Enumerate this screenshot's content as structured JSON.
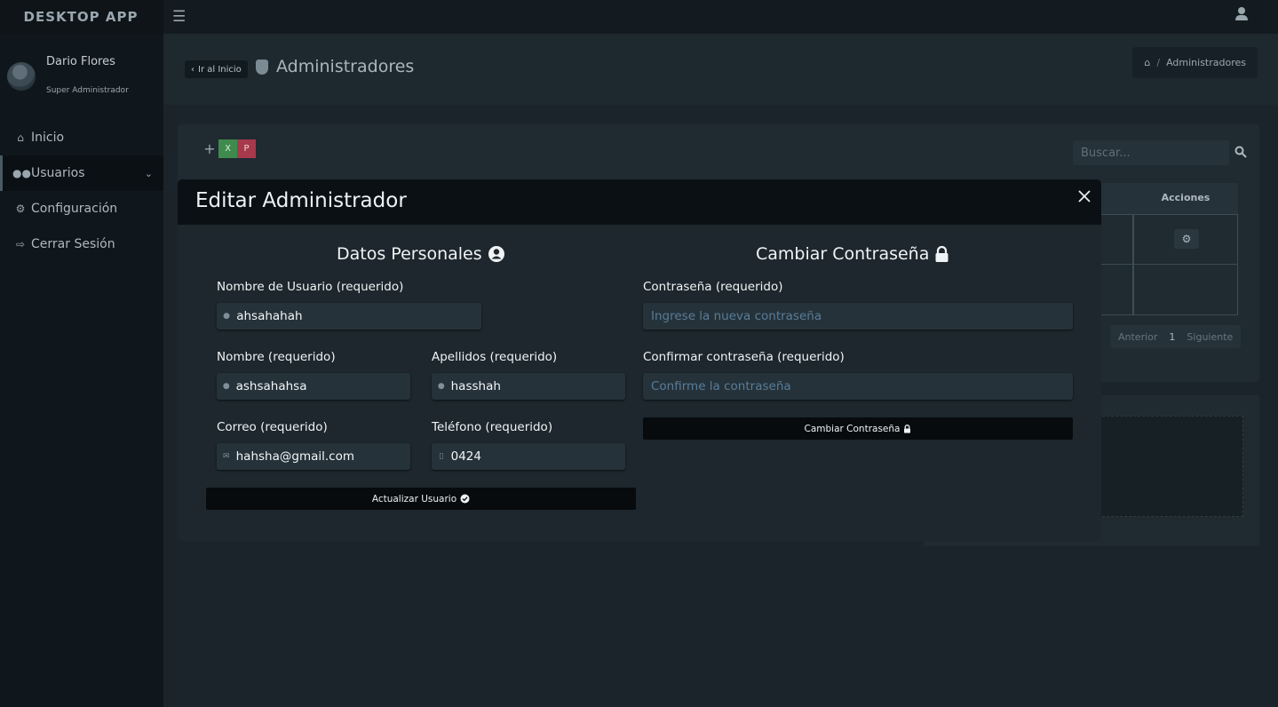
{
  "app": {
    "brand": "DESKTOP APP"
  },
  "user": {
    "name": "Dario Flores",
    "role": "Super Administrador"
  },
  "nav": {
    "items": [
      {
        "label": "Inicio",
        "icon": "home-icon"
      },
      {
        "label": "Usuarios",
        "icon": "users-icon"
      },
      {
        "label": "Configuración",
        "icon": "gear-icon"
      },
      {
        "label": "Cerrar Sesión",
        "icon": "sign-out-icon"
      }
    ]
  },
  "header": {
    "back_label": "Ir al Inicio",
    "title": "Administradores",
    "breadcrumb_current": "Administradores"
  },
  "list": {
    "search_placeholder": "Buscar...",
    "col_actions": "Acciones",
    "pager": {
      "prev": "Anterior",
      "page": "1",
      "next": "Siguiente"
    }
  },
  "modal": {
    "title": "Editar Administrador",
    "personal": {
      "title": "Datos Personales",
      "username_label": "Nombre de Usuario (requerido)",
      "username_value": "ahsahahah",
      "first_name_label": "Nombre (requerido)",
      "first_name_value": "ashsahahsa",
      "last_name_label": "Apellidos (requerido)",
      "last_name_value": "hasshah",
      "email_label": "Correo (requerido)",
      "email_value": "hahsha@gmail.com",
      "phone_label": "Teléfono (requerido)",
      "phone_value": "0424",
      "update_button": "Actualizar Usuario"
    },
    "password": {
      "title": "Cambiar Contraseña",
      "new_label": "Contraseña (requerido)",
      "new_placeholder": "Ingrese la nueva contraseña",
      "confirm_label": "Confirmar contraseña (requerido)",
      "confirm_placeholder": "Confirme la contraseña",
      "change_button": "Cambiar Contraseña"
    }
  }
}
